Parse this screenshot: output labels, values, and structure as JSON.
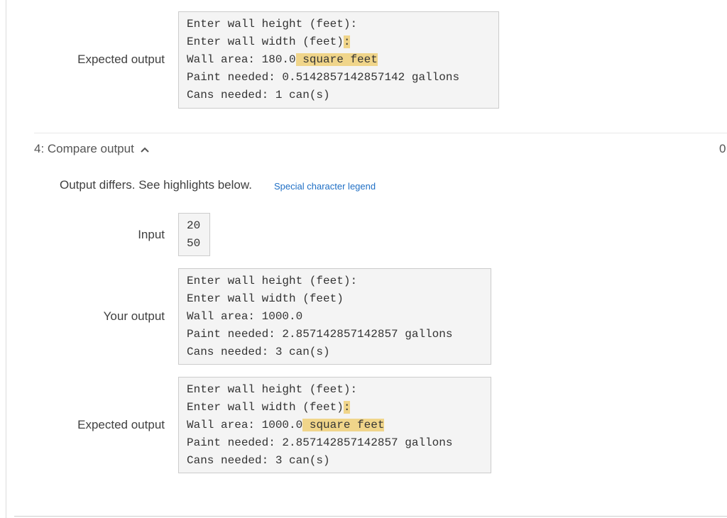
{
  "prev_test": {
    "expected_label": "Expected output",
    "expected_lines": [
      {
        "text": "Enter wall height (feet):"
      },
      {
        "text": "Enter wall width (feet)",
        "hl": ":"
      },
      {
        "text": "Wall area: 180.0",
        "hl": " square feet"
      },
      {
        "text": "Paint needed: 0.5142857142857142 gallons"
      },
      {
        "text": "Cans needed: 1 can(s)"
      }
    ]
  },
  "test4": {
    "header": "4: Compare output",
    "score": "0",
    "differs_msg": "Output differs. See highlights below.",
    "legend_link": "Special character legend",
    "input_label": "Input",
    "input_lines": [
      "20",
      "50"
    ],
    "your_label": "Your output",
    "your_lines": [
      "Enter wall height (feet):",
      "Enter wall width (feet)",
      "Wall area: 1000.0",
      "Paint needed: 2.857142857142857 gallons",
      "Cans needed: 3 can(s)"
    ],
    "expected_label": "Expected output",
    "expected_lines": [
      {
        "text": "Enter wall height (feet):"
      },
      {
        "text": "Enter wall width (feet)",
        "hl": ":"
      },
      {
        "text": "Wall area: 1000.0",
        "hl": " square feet"
      },
      {
        "text": "Paint needed: 2.857142857142857 gallons"
      },
      {
        "text": "Cans needed: 3 can(s)"
      }
    ]
  },
  "colors": {
    "highlight": "#f0d58a",
    "link": "#1f6fc5",
    "codebox_bg": "#f4f4f4"
  }
}
